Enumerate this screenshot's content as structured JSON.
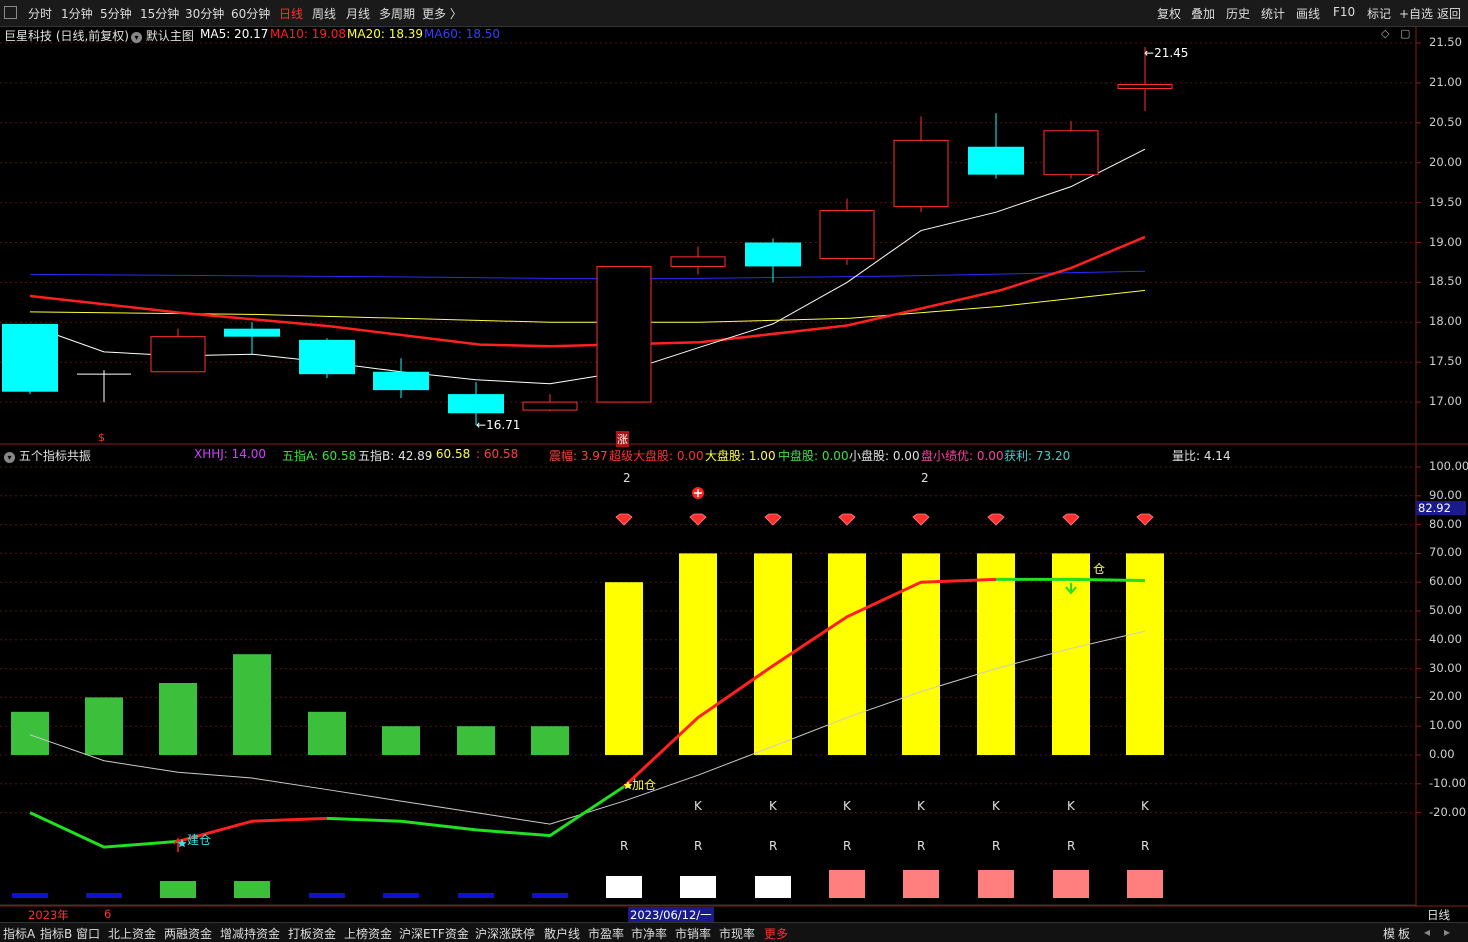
{
  "topbar": {
    "periods": [
      "分时",
      "1分钟",
      "5分钟",
      "15分钟",
      "30分钟",
      "60分钟",
      "日线",
      "周线",
      "月线",
      "多周期",
      "更多 〉"
    ],
    "active_period": "日线",
    "tools": [
      "复权",
      "叠加",
      "历史",
      "统计",
      "画线",
      "F10",
      "标记",
      "+自选",
      "返回"
    ]
  },
  "main_chart": {
    "stock_title": "巨星科技 (日线,前复权)",
    "template": "默认主图",
    "ma5": "MA5: 20.17",
    "ma10": "MA10: 19.08",
    "ma20": "MA20: 18.39",
    "ma60": "MA60: 18.50",
    "high_label": "21.45",
    "low_label": "16.71",
    "mark_s": "$",
    "mark_zhang": "涨",
    "y_ticks": [
      "21.50",
      "21.00",
      "20.50",
      "20.00",
      "19.50",
      "19.00",
      "18.50",
      "18.00",
      "17.50",
      "17.00"
    ],
    "colors": {
      "ma5": "#ffffff",
      "ma10": "#ff2020",
      "ma20": "#ffff40",
      "ma60": "#2a2aff",
      "up": "#ff3030",
      "down": "#00ffff"
    }
  },
  "indicator": {
    "name": "五个指标共振",
    "xhhj": "XHHJ: 14.00",
    "wa": "五指A: 60.58",
    "wb": "五指B: 42.89",
    "wb2": ": 60.58",
    "wb3": ": 60.58",
    "zhenfu": "震幅: 3.97",
    "chaoji": "超级大盘股: 0.00",
    "dapan": "大盘股: 1.00",
    "zhongpan": "中盘股: 0.00",
    "xiaopan": "小盘股: 0.00",
    "panxiao": "盘小绩优: 0.00",
    "huoli": "获利: 73.20",
    "liangbi": "量比: 4.14",
    "cur_value": "82.92",
    "y_ticks": [
      "100.00",
      "90.00",
      "80.00",
      "70.00",
      "60.00",
      "50.00",
      "40.00",
      "30.00",
      "20.00",
      "10.00",
      "0.00",
      "-10.00",
      "-20.00"
    ],
    "label_jiancang": "建仓",
    "label_jiacang": "加仓",
    "label_jiancang2": "减仓",
    "count_labels": [
      "2",
      "2"
    ],
    "k_label": "K",
    "r_label": "R",
    "green_bars": [
      15,
      20,
      25,
      35,
      15,
      10,
      10,
      10
    ],
    "yellow_bars": [
      60,
      70,
      70,
      70,
      70,
      70,
      70,
      70
    ]
  },
  "date_axis": {
    "year": "2023年",
    "month": "6",
    "cursor_date": "2023/06/12/一",
    "period": "日线"
  },
  "bottom_tabs": [
    "指标A",
    "指标B",
    "窗口",
    "北上资金",
    "两融资金",
    "增减持资金",
    "打板资金",
    "上榜资金",
    "沪深ETF资金",
    "沪深涨跌停",
    "散户线",
    "市盈率",
    "市净率",
    "市销率",
    "市现率",
    "更多"
  ],
  "bottom_right": [
    "模",
    "板"
  ]
}
